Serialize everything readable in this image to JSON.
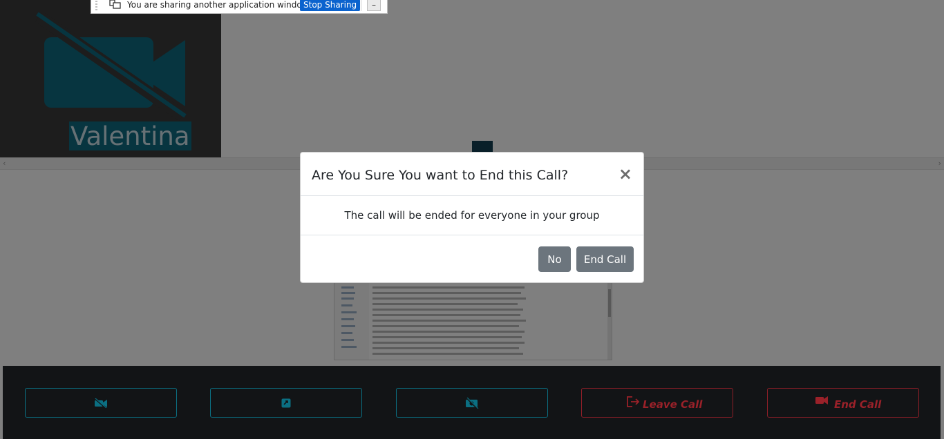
{
  "participant": {
    "name": "Valentina"
  },
  "share_bar": {
    "message": "You are sharing another application window.",
    "stop_label": "Stop Sharing",
    "minimize_label": "–"
  },
  "modal": {
    "title": "Are You Sure You want to End this Call?",
    "close_label": "×",
    "body": "The call will be ended for everyone in your group",
    "no_label": "No",
    "end_label": "End Call"
  },
  "toolbar": {
    "video_toggle_icon": "video-off-icon",
    "screen_share_icon": "share-icon",
    "camera_off_icon": "camera-off-icon",
    "leave_label": "Leave Call",
    "end_label": "End Call"
  },
  "colors": {
    "accent": "#0b6f82",
    "danger": "#dc3545",
    "modal_button": "#6c757d"
  }
}
